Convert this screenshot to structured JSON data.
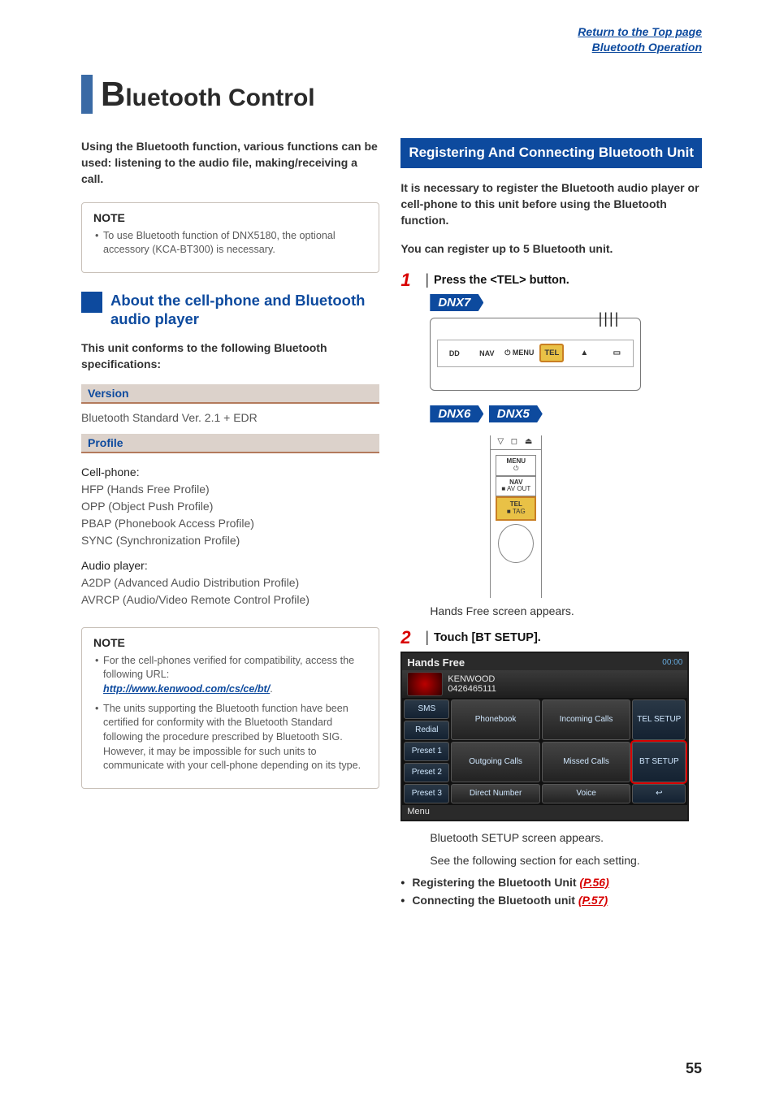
{
  "top_links": {
    "line1": "Return to the Top page",
    "line2": "Bluetooth Operation"
  },
  "title_cap": "B",
  "title_rest": "luetooth Control",
  "page_number": "55",
  "left": {
    "intro": "Using the Bluetooth function, various functions can be used: listening to the audio file, making/receiving a call.",
    "note1": {
      "title": "NOTE",
      "item": "To use Bluetooth function of DNX5180, the optional accessory (KCA-BT300) is necessary."
    },
    "h2": "About the cell-phone and Bluetooth audio player",
    "conform": "This unit conforms to the following Bluetooth specifications:",
    "version_head": "Version",
    "version_val": "Bluetooth Standard Ver. 2.1 + EDR",
    "profile_head": "Profile",
    "profile_cell": "Cell-phone:",
    "p1": "HFP (Hands Free Profile)",
    "p2": "OPP (Object Push Profile)",
    "p3": "PBAP (Phonebook Access Profile)",
    "p4": "SYNC (Synchronization Profile)",
    "profile_audio": "Audio player:",
    "p5": "A2DP (Advanced Audio Distribution Profile)",
    "p6": "AVRCP (Audio/Video Remote Control Profile)",
    "note2": {
      "title": "NOTE",
      "i1a": "For the cell-phones verified for compatibility, access the following URL:",
      "i1_link": "http://www.kenwood.com/cs/ce/bt/",
      "i2": "The units supporting the Bluetooth function have been certified for conformity with the Bluetooth Standard following the procedure prescribed by Bluetooth SIG.",
      "i2b": "However, it may be impossible for such units to communicate with your cell-phone depending on its type."
    }
  },
  "right": {
    "header": "Registering And Connecting Bluetooth Unit",
    "intro1": "It is necessary to register the Bluetooth audio player or cell-phone to this unit before using the Bluetooth function.",
    "intro2": "You can register up to 5 Bluetooth unit.",
    "step1_num": "1",
    "step1_label": "Press the <TEL> button.",
    "badge1": "DNX7",
    "badge2": "DNX6",
    "badge3": "DNX5",
    "panel": {
      "dd": "DD",
      "nav": "NAV",
      "menu": "MENU",
      "tel": "TEL",
      "eject": "▲",
      "reset": "▭"
    },
    "side_panel": {
      "menu": "MENU",
      "nav": "NAV",
      "nav_sub": "■ AV OUT",
      "tel": "TEL",
      "tel_sub": "■ TAG",
      "top_icons": "▽ ◻ ⏏"
    },
    "caption1": "Hands Free screen appears.",
    "step2_num": "2",
    "step2_label": "Touch [BT SETUP].",
    "screenshot": {
      "title": "Hands Free",
      "clock": "00:00",
      "dev_name": "KENWOOD",
      "dev_num": "0426465111",
      "sms": "SMS",
      "redial": "Redial",
      "phonebook": "Phonebook",
      "incoming": "Incoming Calls",
      "tel_setup": "TEL SETUP",
      "preset1": "Preset 1",
      "preset2": "Preset 2",
      "outgoing": "Outgoing Calls",
      "missed": "Missed Calls",
      "bt_setup": "BT SETUP",
      "preset3": "Preset 3",
      "direct": "Direct Number",
      "voice": "Voice",
      "menu": "Menu"
    },
    "result1": "Bluetooth SETUP screen appears.",
    "result2": "See the following section for each setting.",
    "b1_text": "Registering the Bluetooth Unit ",
    "b1_link": "(P.56)",
    "b2_text": "Connecting the Bluetooth unit ",
    "b2_link": "(P.57)"
  }
}
